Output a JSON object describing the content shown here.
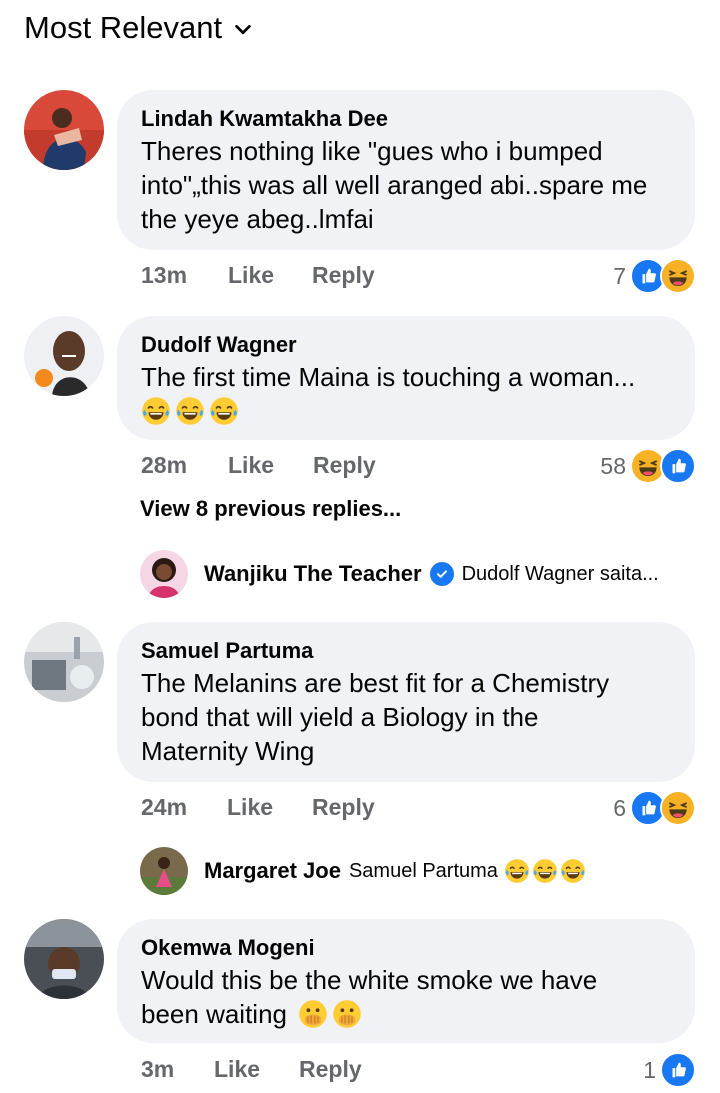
{
  "sort": {
    "label": "Most Relevant"
  },
  "comments": [
    {
      "author": "Lindah Kwamtakha Dee",
      "lines": [
        "Theres nothing like \"gues who i bumped",
        "into\"„this was all well aranged abi..spare me",
        "the yeye abeg..lmfai"
      ],
      "time": "13m",
      "like": "Like",
      "reply": "Reply",
      "reactions": "7",
      "reaction_icons": [
        "like-icon",
        "haha-icon"
      ]
    },
    {
      "author": "Dudolf Wagner",
      "lines": [
        "The first time Maina is touching a woman..."
      ],
      "emoji_line": [
        "tears-of-joy-icon",
        "tears-of-joy-icon",
        "tears-of-joy-icon"
      ],
      "time": "28m",
      "like": "Like",
      "reply": "Reply",
      "reactions": "58",
      "reaction_icons": [
        "haha-icon",
        "like-icon"
      ],
      "view_previous": "View 8 previous replies...",
      "reply_preview": {
        "author": "Wanjiku The Teacher",
        "verified": true,
        "text": "Dudolf Wagner saita..."
      }
    },
    {
      "author": "Samuel Partuma",
      "lines": [
        "The Melanins are best fit for a Chemistry",
        "bond that will yield a Biology in the",
        "Maternity Wing"
      ],
      "time": "24m",
      "like": "Like",
      "reply": "Reply",
      "reactions": "6",
      "reaction_icons": [
        "like-icon",
        "haha-icon"
      ],
      "reply_preview": {
        "author": "Margaret Joe",
        "verified": false,
        "text": "Samuel Partuma",
        "emojis": [
          "tears-of-joy-icon",
          "tears-of-joy-icon",
          "tears-of-joy-icon"
        ]
      }
    },
    {
      "author": "Okemwa Mogeni",
      "lines": [
        "Would this be the white smoke we have",
        "been waiting"
      ],
      "line_emojis": [
        "face-with-hand-over-mouth-icon",
        "face-with-hand-over-mouth-icon"
      ],
      "time": "3m",
      "like": "Like",
      "reply": "Reply",
      "reactions": "1",
      "reaction_icons": [
        "like-icon"
      ]
    }
  ],
  "colors": {
    "like_blue": "#1877f2",
    "haha_yellow": "#f7b125",
    "bubble_bg": "#f0f2f5",
    "meta_gray": "#65676b"
  }
}
